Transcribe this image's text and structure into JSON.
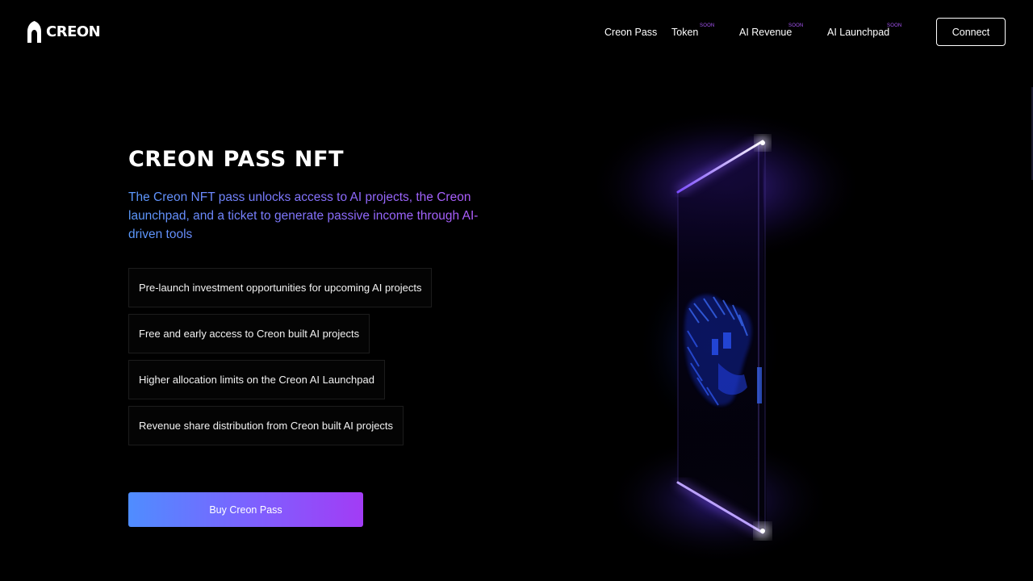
{
  "brand": {
    "name": "CREON"
  },
  "nav": {
    "items": [
      {
        "label": "Creon Pass",
        "badge": ""
      },
      {
        "label": "Token",
        "badge": "SOON"
      },
      {
        "label": "AI Revenue",
        "badge": "SOON"
      },
      {
        "label": "AI Launchpad",
        "badge": "SOON"
      }
    ],
    "connect_label": "Connect"
  },
  "hero": {
    "title": "CREON PASS NFT",
    "subtitle": "The Creon NFT pass unlocks access to AI projects, the Creon launchpad, and a ticket to generate passive income through AI-driven tools",
    "features": [
      "Pre-launch investment opportunities for upcoming AI projects",
      "Free and early access to Creon built AI projects",
      "Higher allocation limits on the Creon AI Launchpad",
      "Revenue share distribution from Creon built AI projects"
    ],
    "cta_label": "Buy Creon Pass"
  },
  "colors": {
    "background": "#000000",
    "soon_badge": "#a855f7",
    "gradient_start": "#4f8dff",
    "gradient_end": "#a23cf5",
    "neon": "#8a5cff"
  }
}
